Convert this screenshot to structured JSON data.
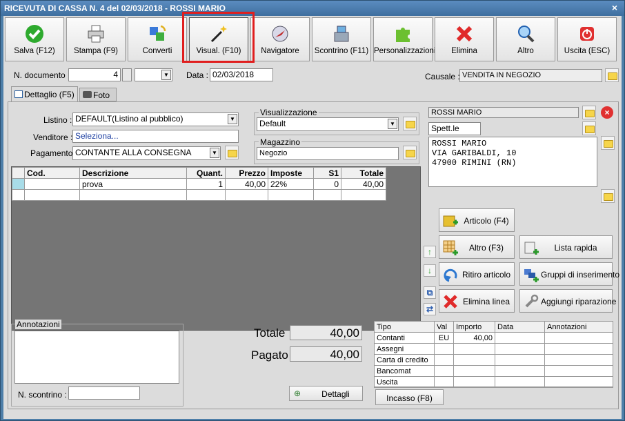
{
  "window": {
    "title": "RICEVUTA DI CASSA N. 4 del 02/03/2018 - ROSSI MARIO",
    "close": "×"
  },
  "toolbar": [
    {
      "label": "Salva (F12)",
      "icon": "check-icon"
    },
    {
      "label": "Stampa (F9)",
      "icon": "printer-icon"
    },
    {
      "label": "Converti",
      "icon": "convert-icon"
    },
    {
      "label": "Visual. (F10)",
      "icon": "magic-wand-icon"
    },
    {
      "label": "Navigatore",
      "icon": "compass-icon"
    },
    {
      "label": "Scontrino (F11)",
      "icon": "cash-register-icon"
    },
    {
      "label": "Personalizzazioni",
      "icon": "puzzle-icon"
    },
    {
      "label": "Elimina",
      "icon": "delete-x-icon"
    },
    {
      "label": "Altro",
      "icon": "magnifier-icon"
    },
    {
      "label": "Uscita (ESC)",
      "icon": "exit-icon"
    }
  ],
  "header": {
    "ndoc_label": "N. documento :",
    "ndoc_value": "4",
    "data_label": "Data :",
    "data_value": "02/03/2018",
    "causale_label": "Causale :",
    "causale_value": "VENDITA IN NEGOZIO"
  },
  "tabs": {
    "dettaglio": "Dettaglio (F5)",
    "foto": "Foto"
  },
  "form": {
    "listino_label": "Listino :",
    "listino_value": "DEFAULT(Listino al pubblico)",
    "venditore_label": "Venditore :",
    "venditore_value": "Seleziona...",
    "pagamento_label": "Pagamento :",
    "pagamento_value": "CONTANTE ALLA CONSEGNA",
    "visualizzazione_title": "Visualizzazione",
    "visualizzazione_value": "Default",
    "magazzino_title": "Magazzino",
    "magazzino_value": "Negozio"
  },
  "customer": {
    "name": "ROSSI MARIO",
    "title": "Spett.le",
    "address": [
      "ROSSI MARIO",
      "VIA GARIBALDI, 10",
      "47900 RIMINI (RN)"
    ]
  },
  "grid": {
    "headers": [
      "Cod.",
      "Descrizione",
      "Quant.",
      "Prezzo",
      "Imposte",
      "S1",
      "Totale"
    ],
    "rows": [
      [
        "",
        "prova",
        "1",
        "40,00",
        "22%",
        "0",
        "40,00"
      ]
    ]
  },
  "actions": {
    "articolo": "Articolo (F4)",
    "altro": "Altro (F3)",
    "lista_rapida": "Lista rapida",
    "ritiro": "Ritiro articolo",
    "gruppi": "Gruppi di inserimento",
    "elimina_linea": "Elimina linea",
    "riparazione": "Aggiungi riparazione"
  },
  "notes": {
    "title": "Annotazioni",
    "scontrino_label": "N. scontrino :"
  },
  "totals": {
    "totale_label": "Totale",
    "totale_value": "40,00",
    "pagato_label": "Pagato",
    "pagato_value": "40,00",
    "dettagli": "Dettagli"
  },
  "payments": {
    "headers": [
      "Tipo",
      "Val",
      "Importo",
      "Data",
      "Annotazioni"
    ],
    "rows": [
      [
        "Contanti",
        "EU",
        "40,00",
        "",
        ""
      ],
      [
        "Assegni",
        "",
        "",
        "",
        ""
      ],
      [
        "Carta di credito",
        "",
        "",
        "",
        ""
      ],
      [
        "Bancomat",
        "",
        "",
        "",
        ""
      ],
      [
        "Uscita",
        "",
        "",
        "",
        ""
      ]
    ],
    "incasso": "Incasso (F8)"
  }
}
